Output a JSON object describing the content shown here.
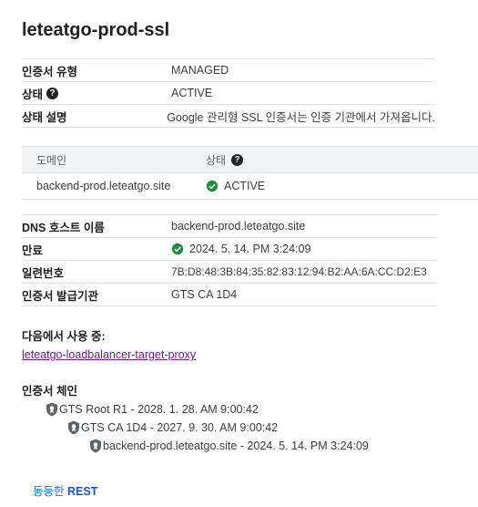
{
  "page_title": "leteatgo-prod-ssl",
  "details": [
    {
      "label": "인증서 유형",
      "value": "MANAGED",
      "help": false
    },
    {
      "label": "상태",
      "value": "ACTIVE",
      "help": true
    },
    {
      "label": "상태 설명",
      "value": "Google 관리형 SSL 인증서는 인증 기관에서 가져옵니다.",
      "help": false
    }
  ],
  "domain_table": {
    "headers": {
      "domain": "도메인",
      "status": "상태"
    },
    "rows": [
      {
        "domain": "backend-prod.leteatgo.site",
        "status": "ACTIVE"
      }
    ]
  },
  "cert_info": [
    {
      "label": "DNS 호스트 이름",
      "value": "backend-prod.leteatgo.site",
      "check": false
    },
    {
      "label": "만료",
      "value": "2024. 5. 14. PM 3:24:09",
      "check": true
    },
    {
      "label": "일련번호",
      "value": "7B:D8:48:3B:84:35:82:83:12:94:B2:AA:6A:CC:D2:E3",
      "check": false
    },
    {
      "label": "인증서 발급기관",
      "value": "GTS CA 1D4",
      "check": false
    }
  ],
  "used_by": {
    "label": "다음에서 사용 중:",
    "link": "leteatgo-loadbalancer-target-proxy"
  },
  "chain": {
    "label": "인증서 체인",
    "items": [
      "GTS Root R1 - 2028. 1. 28. AM 9:00:42",
      "GTS CA 1D4 - 2027. 9. 30. AM 9:00:42",
      "backend-prod.leteatgo.site - 2024. 5. 14. PM 3:24:09"
    ]
  },
  "rest": {
    "prefix": "동등한",
    "label": "REST"
  },
  "colors": {
    "success": "#1e8e3e",
    "link_visited": "#6a1b9a",
    "link": "#1a73e8"
  },
  "icons": {
    "help": "help-icon",
    "check": "check-circle-icon",
    "shield": "shield-icon"
  }
}
